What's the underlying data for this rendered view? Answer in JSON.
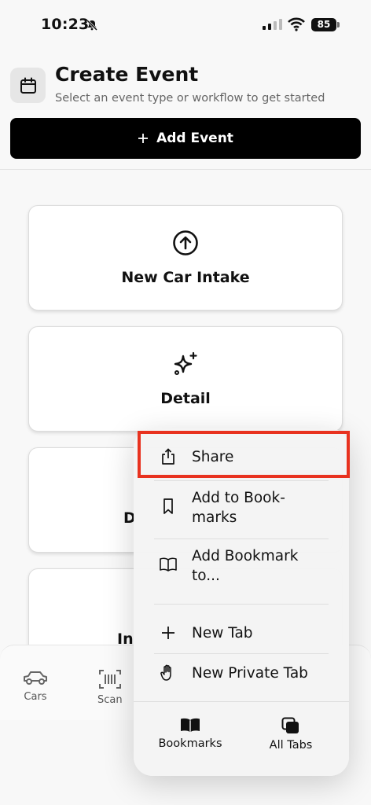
{
  "status_bar": {
    "time": "10:23",
    "battery": "85"
  },
  "header": {
    "title": "Create Event",
    "subtitle": "Select an event type or workflow to get started",
    "add_button": "Add Event",
    "add_button_icon": "plus-icon"
  },
  "cards": [
    {
      "label": "New Car Intake",
      "icon": "arrow-up-circle-icon"
    },
    {
      "label": "Detail",
      "icon": "sparkles-icon"
    },
    {
      "label": "D",
      "icon": ""
    },
    {
      "label": "In",
      "icon": ""
    }
  ],
  "tabbar": {
    "items": [
      {
        "label": "Cars",
        "icon": "car-icon"
      },
      {
        "label": "Scan",
        "icon": "barcode-scan-icon"
      }
    ]
  },
  "menu": {
    "items": [
      {
        "label": "Share",
        "icon": "share-icon"
      },
      {
        "label": "Add to Book-marks",
        "line1": "Add to Book-",
        "line2": "marks",
        "icon": "bookmark-icon"
      },
      {
        "label": "Add Bookmark to...",
        "line1": "Add Bookmark",
        "line2": "to...",
        "icon": "book-open-icon"
      },
      {
        "label": "New Tab",
        "icon": "plus-icon"
      },
      {
        "label": "New Private Tab",
        "icon": "hand-icon"
      }
    ],
    "bottom": [
      {
        "label": "Bookmarks",
        "icon": "book-filled-icon"
      },
      {
        "label": "All Tabs",
        "icon": "tabs-stack-icon"
      }
    ],
    "highlight_color": "#e8321f"
  }
}
